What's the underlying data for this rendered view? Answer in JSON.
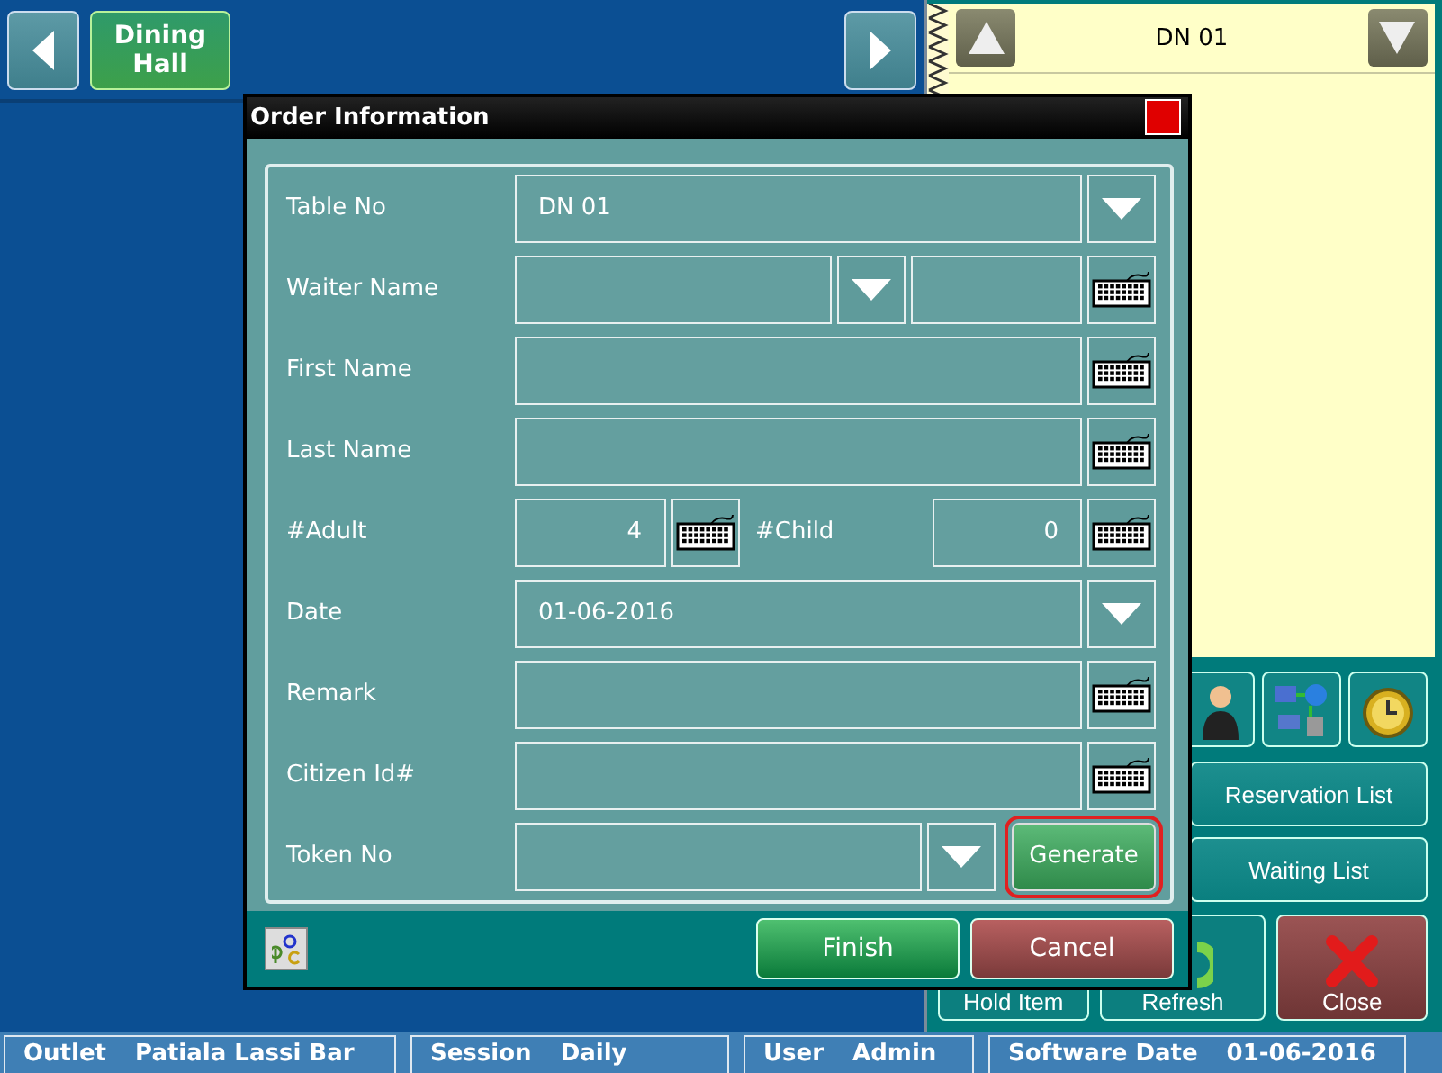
{
  "nav": {
    "area_tab": {
      "label": "Dining Hall",
      "selected": true
    }
  },
  "ticket": {
    "table": "DN 01"
  },
  "side_buttons": [
    {
      "label": "Reservation List"
    },
    {
      "label": "Waiting List"
    }
  ],
  "bottom_buttons": [
    {
      "label": "Hold Item",
      "kind": "hold"
    },
    {
      "label": "Refresh",
      "kind": "refresh"
    },
    {
      "label": "Close",
      "kind": "close"
    }
  ],
  "dialog": {
    "title": "Order Information",
    "fields": [
      {
        "kind": "select",
        "label": "Table No",
        "value": "DN 01"
      },
      {
        "kind": "waiter",
        "label": "Waiter Name"
      },
      {
        "kind": "text",
        "label": "First Name"
      },
      {
        "kind": "text",
        "label": "Last Name"
      },
      {
        "kind": "counts",
        "label": "#Adult",
        "value": "4",
        "second_label": "#Child",
        "second_value": "0"
      },
      {
        "kind": "select",
        "label": "Date",
        "value": "01-06-2016"
      },
      {
        "kind": "text",
        "label": "Remark"
      },
      {
        "kind": "text",
        "label": "Citizen Id#"
      },
      {
        "kind": "token",
        "label": "Token No"
      }
    ],
    "generate": {
      "label": "Generate",
      "focused": true
    },
    "buttons": [
      {
        "label": "Finish",
        "kind": "confirm"
      },
      {
        "label": "Cancel",
        "kind": "cancel"
      }
    ]
  },
  "status_bar": [
    {
      "label": "Outlet",
      "value": "Patiala Lassi Bar"
    },
    {
      "label": "Session",
      "value": "Daily"
    },
    {
      "label": "User",
      "value": "Admin"
    },
    {
      "label": "Software Date",
      "value": "01-06-2016"
    }
  ]
}
